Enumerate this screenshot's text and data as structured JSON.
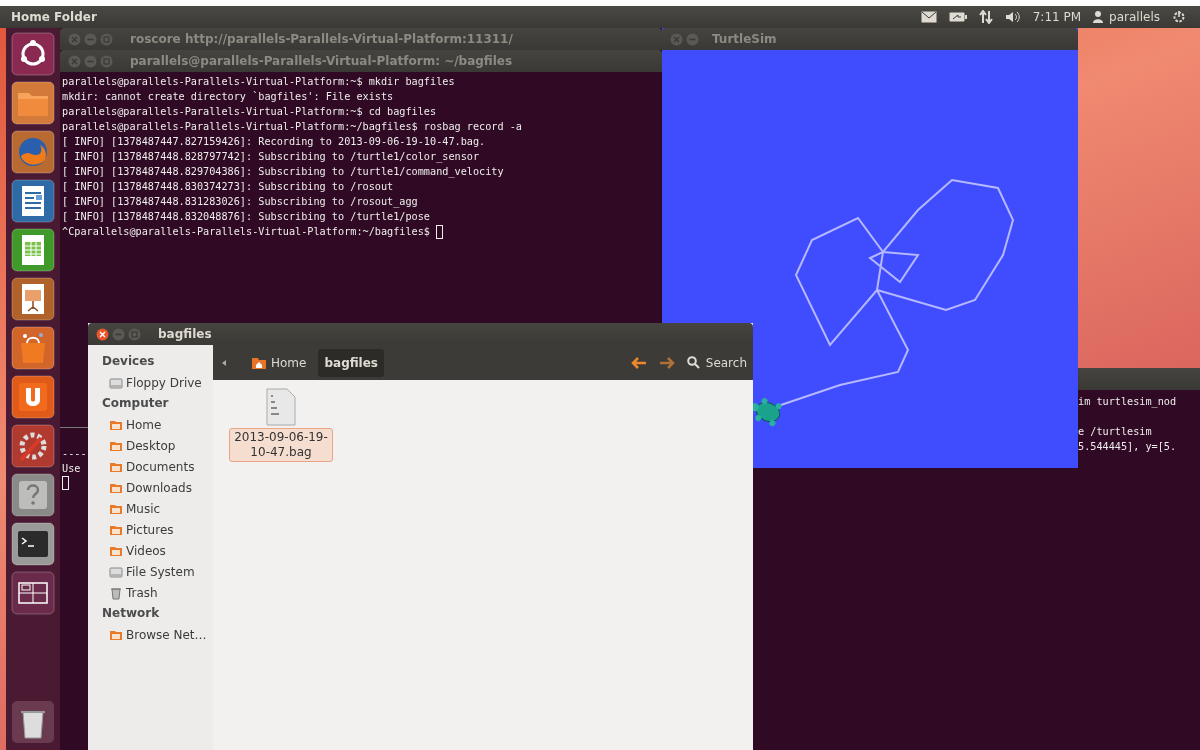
{
  "top_panel": {
    "title": "Home Folder",
    "clock": "7:11 PM",
    "user": "parallels"
  },
  "terminals": [
    {
      "title": "roscore http://parallels-Parallels-Virtual-Platform:11311/",
      "lines": [
        "----",
        "Use"
      ],
      "cursor": true
    },
    {
      "title": "parallels@parallels-Parallels-Virtual-Platform: ~/bagfiles",
      "lines": [
        "parallels@parallels-Parallels-Virtual-Platform:~$ mkdir bagfiles",
        "mkdir: cannot create directory `bagfiles': File exists",
        "parallels@parallels-Parallels-Virtual-Platform:~$ cd bagfiles",
        "parallels@parallels-Parallels-Virtual-Platform:~/bagfiles$ rosbag record -a",
        "[ INFO] [1378487447.827159426]: Recording to 2013-09-06-19-10-47.bag.",
        "[ INFO] [1378487448.828797742]: Subscribing to /turtle1/color_sensor",
        "[ INFO] [1378487448.829704386]: Subscribing to /turtle1/command_velocity",
        "[ INFO] [1378487448.830374273]: Subscribing to /rosout",
        "[ INFO] [1378487448.831283026]: Subscribing to /rosout_agg",
        "[ INFO] [1378487448.832048876]: Subscribing to /turtle1/pose",
        "^Cparallels@parallels-Parallels-Virtual-Platform:~/bagfiles$ "
      ],
      "cursor": true
    },
    {
      "blocks": [
        [
          "im turtlesim_nod"
        ],
        [
          "e /turtlesim",
          "5.544445], y=[5."
        ]
      ]
    }
  ],
  "turtlesim": {
    "title": "TurtleSim"
  },
  "file_manager": {
    "title": "bagfiles",
    "sidebar": [
      {
        "heading": "Devices",
        "items": [
          {
            "label": "Floppy Drive",
            "kind": "drive"
          }
        ]
      },
      {
        "heading": "Computer",
        "items": [
          {
            "label": "Home",
            "kind": "folder"
          },
          {
            "label": "Desktop",
            "kind": "folder"
          },
          {
            "label": "Documents",
            "kind": "folder"
          },
          {
            "label": "Downloads",
            "kind": "folder"
          },
          {
            "label": "Music",
            "kind": "folder"
          },
          {
            "label": "Pictures",
            "kind": "folder"
          },
          {
            "label": "Videos",
            "kind": "folder"
          },
          {
            "label": "File System",
            "kind": "drive"
          },
          {
            "label": "Trash",
            "kind": "trash"
          }
        ]
      },
      {
        "heading": "Network",
        "items": [
          {
            "label": "Browse Net…",
            "kind": "folder"
          }
        ]
      }
    ],
    "breadcrumbs": [
      {
        "label": "Home",
        "selected": false
      },
      {
        "label": "bagfiles",
        "selected": true
      }
    ],
    "search": "Search",
    "files": [
      {
        "name": "2013-09-06-19-10-47.bag",
        "selected": true
      }
    ]
  }
}
